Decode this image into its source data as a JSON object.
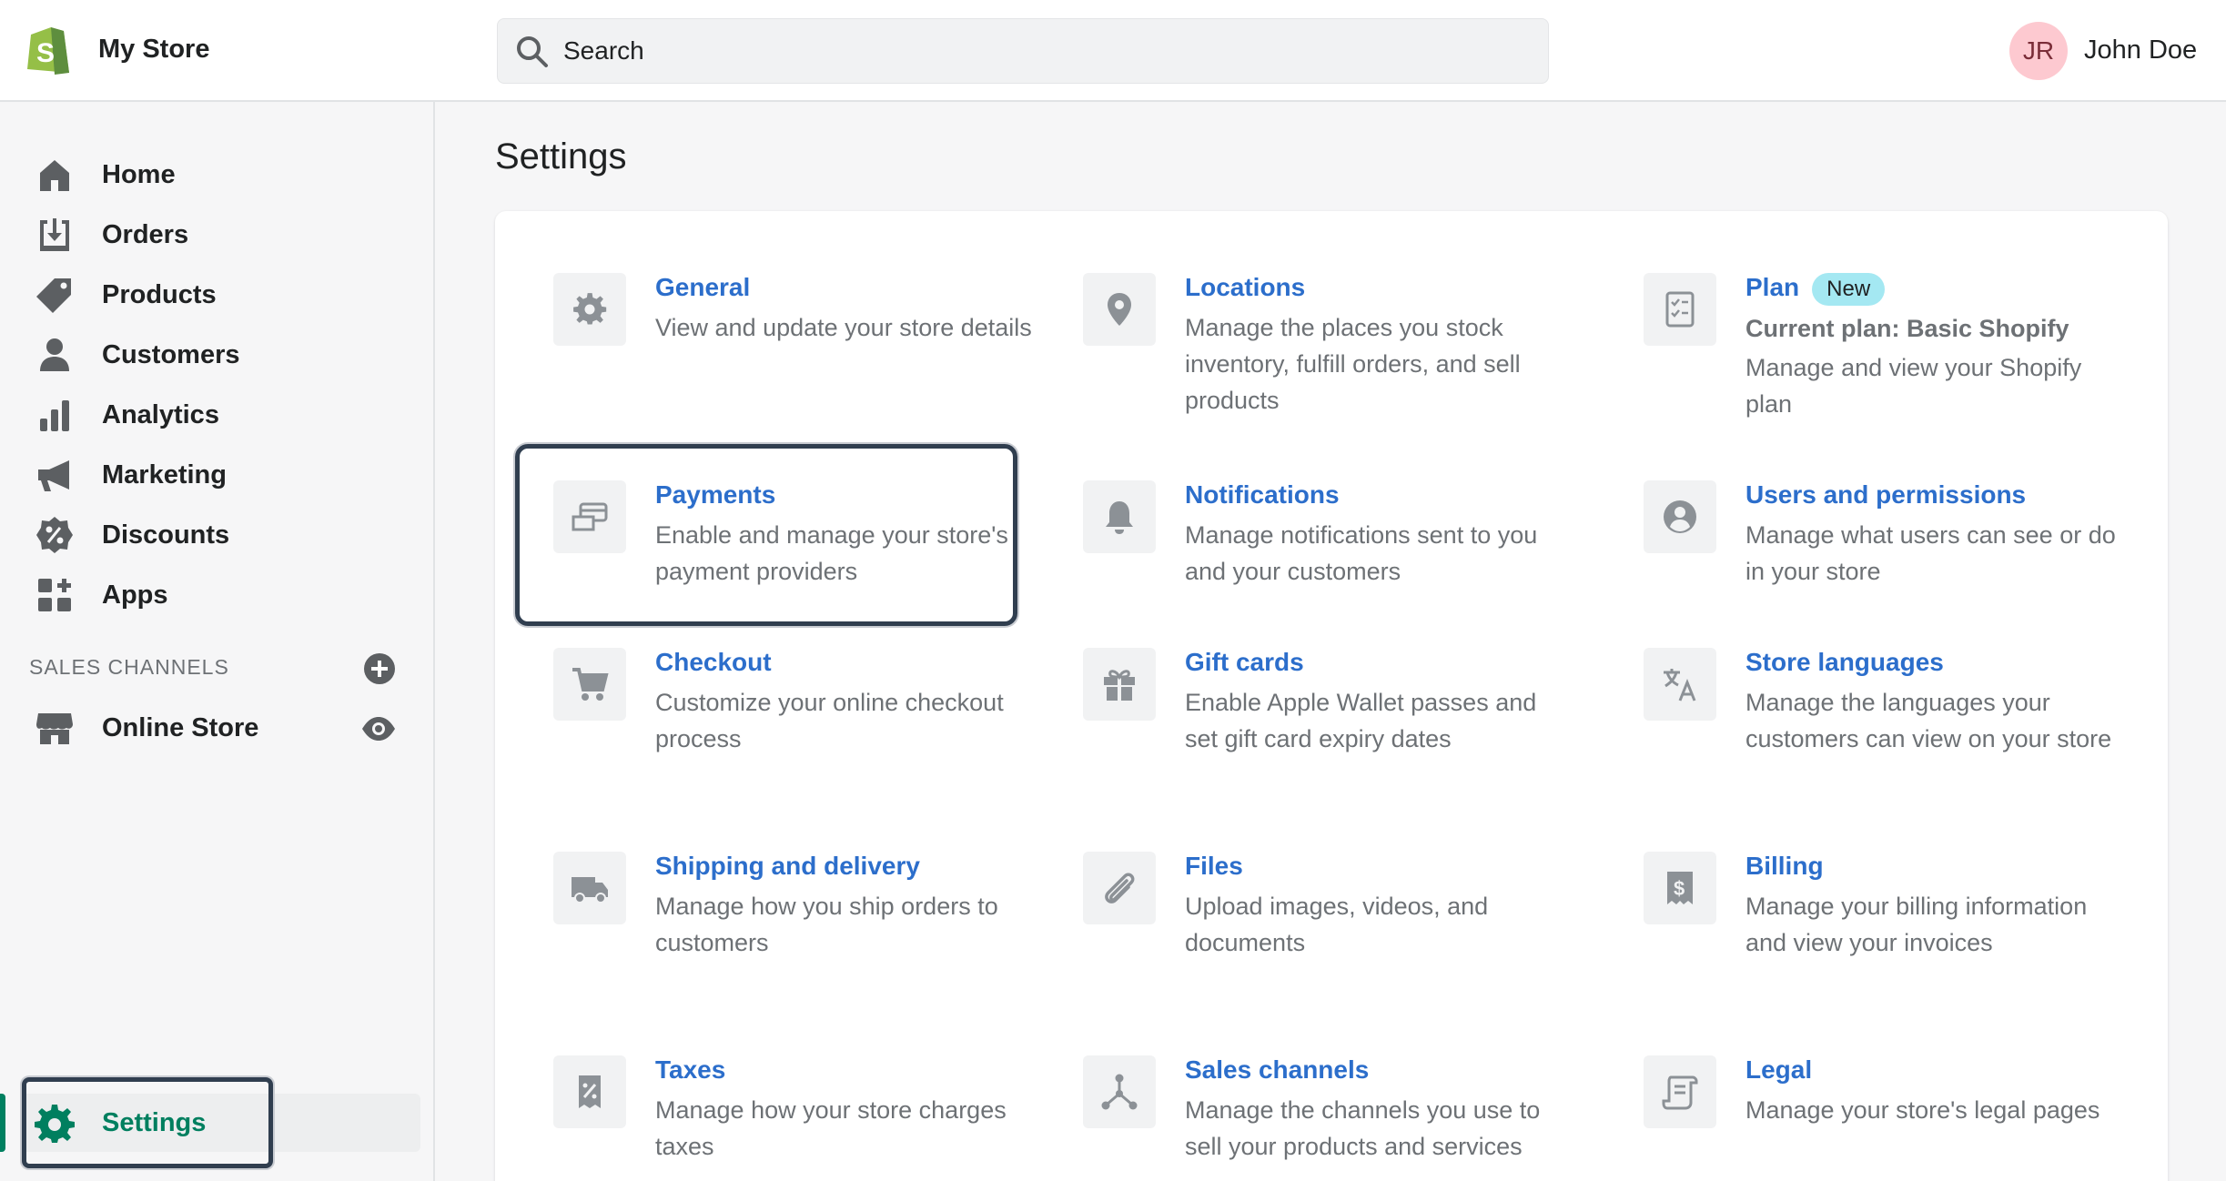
{
  "topbar": {
    "store_name": "My Store",
    "search_placeholder": "Search",
    "avatar_initials": "JR",
    "user_name": "John Doe"
  },
  "sidebar": {
    "items": [
      {
        "label": "Home",
        "icon": "home-icon"
      },
      {
        "label": "Orders",
        "icon": "orders-icon"
      },
      {
        "label": "Products",
        "icon": "tag-icon"
      },
      {
        "label": "Customers",
        "icon": "person-icon"
      },
      {
        "label": "Analytics",
        "icon": "bar-chart-icon"
      },
      {
        "label": "Marketing",
        "icon": "megaphone-icon"
      },
      {
        "label": "Discounts",
        "icon": "discount-icon"
      },
      {
        "label": "Apps",
        "icon": "apps-icon"
      }
    ],
    "sales_channels_title": "SALES CHANNELS",
    "online_store_label": "Online Store",
    "settings_label": "Settings"
  },
  "main": {
    "title": "Settings",
    "tiles": [
      {
        "title": "General",
        "desc": "View and update your store details",
        "icon": "gear-icon"
      },
      {
        "title": "Locations",
        "desc": "Manage the places you stock inventory, fulfill orders, and sell products",
        "icon": "location-pin-icon"
      },
      {
        "title": "Plan",
        "badge": "New",
        "subtitle": "Current plan: Basic Shopify",
        "desc": "Manage and view your Shopify plan",
        "icon": "checklist-icon"
      },
      {
        "title": "Payments",
        "desc": "Enable and manage your store's payment providers",
        "icon": "payment-card-icon"
      },
      {
        "title": "Notifications",
        "desc": "Manage notifications sent to you and your customers",
        "icon": "bell-icon"
      },
      {
        "title": "Users and permissions",
        "desc": "Manage what users can see or do in your store",
        "icon": "user-circle-icon"
      },
      {
        "title": "Checkout",
        "desc": "Customize your online checkout process",
        "icon": "cart-icon"
      },
      {
        "title": "Gift cards",
        "desc": "Enable Apple Wallet passes and set gift card expiry dates",
        "icon": "gift-icon"
      },
      {
        "title": "Store languages",
        "desc": "Manage the languages your customers can view on your store",
        "icon": "translate-icon"
      },
      {
        "title": "Shipping and delivery",
        "desc": "Manage how you ship orders to customers",
        "icon": "truck-icon"
      },
      {
        "title": "Files",
        "desc": "Upload images, videos, and documents",
        "icon": "paperclip-icon"
      },
      {
        "title": "Billing",
        "desc": "Manage your billing information and view your invoices",
        "icon": "receipt-dollar-icon"
      },
      {
        "title": "Taxes",
        "desc": "Manage how your store charges taxes",
        "icon": "tax-icon"
      },
      {
        "title": "Sales channels",
        "desc": "Manage the channels you use to sell your products and services",
        "icon": "channels-icon"
      },
      {
        "title": "Legal",
        "desc": "Manage your store's legal pages",
        "icon": "scroll-icon"
      }
    ]
  },
  "colors": {
    "link": "#2c6ecb",
    "active_green": "#007f5f",
    "icon_gray": "#8c9196",
    "badge": "#a4e8f2"
  }
}
